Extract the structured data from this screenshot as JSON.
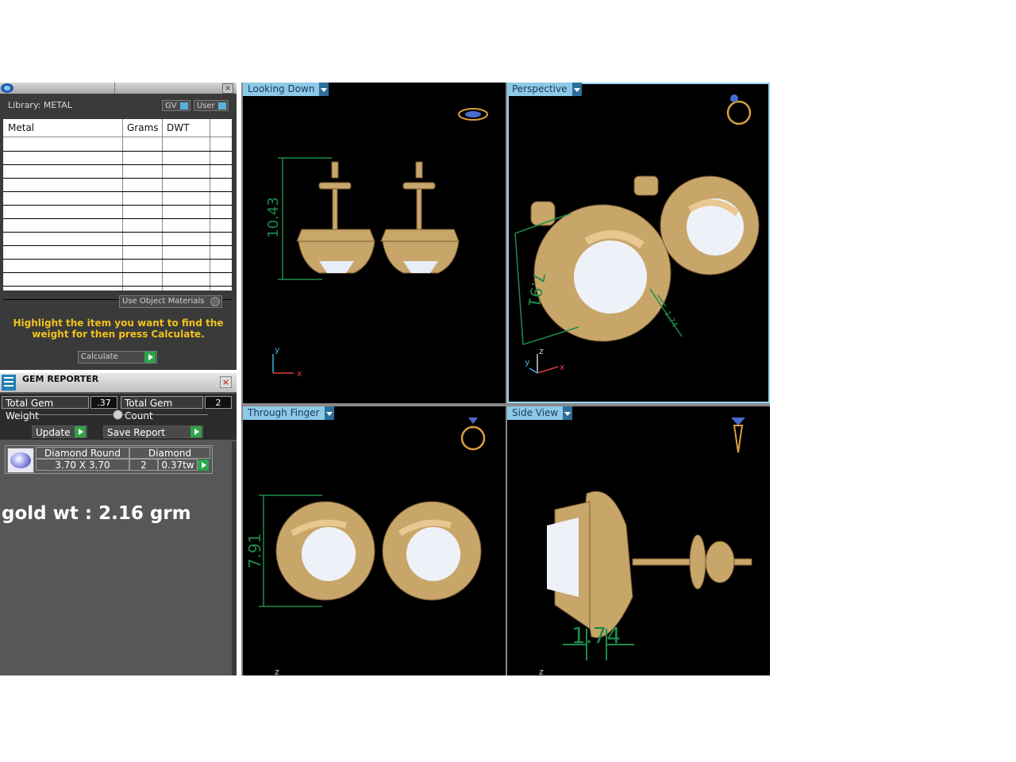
{
  "metal_panel": {
    "library_label": "Library: METAL",
    "gv_label": "GV",
    "user_label": "User",
    "columns": [
      "Metal",
      "Grams",
      "DWT"
    ],
    "use_object_materials": "Use Object Materials",
    "instruction": "Highlight the item you want to find the weight for then press Calculate.",
    "calculate_label": "Calculate",
    "close_glyph": "×"
  },
  "gem_reporter": {
    "title": "GEM REPORTER",
    "close_glyph": "×",
    "total_weight_label": "Total Gem Weight",
    "total_weight_value": ".37",
    "total_count_label": "Total Gem Count",
    "total_count_value": "2",
    "update_label": "Update",
    "save_report_label": "Save Report",
    "gem": {
      "shape": "Diamond Round",
      "material": "Diamond",
      "size": "3.70 X 3.70",
      "count": "2",
      "weight": "0.37tw"
    }
  },
  "annotation": "gold wt : 2.16 grm",
  "viewports": [
    {
      "label": "Looking Down",
      "dimension": "10.43",
      "axis_a": "y",
      "axis_b": "x"
    },
    {
      "label": "Perspective",
      "dimension": "7.91",
      "dimension_b": "1.74",
      "axis_a": "z",
      "axis_b": "x",
      "axis_c": "y"
    },
    {
      "label": "Through Finger",
      "dimension": "7.91",
      "axis_a": "z"
    },
    {
      "label": "Side View",
      "dimension": "1.74",
      "axis_a": "z"
    }
  ],
  "colors": {
    "accent": "#8ec9e8",
    "gold": "#d9b57a",
    "dimension_green": "#1e8a4a",
    "highlight_text": "#f2c21b"
  }
}
